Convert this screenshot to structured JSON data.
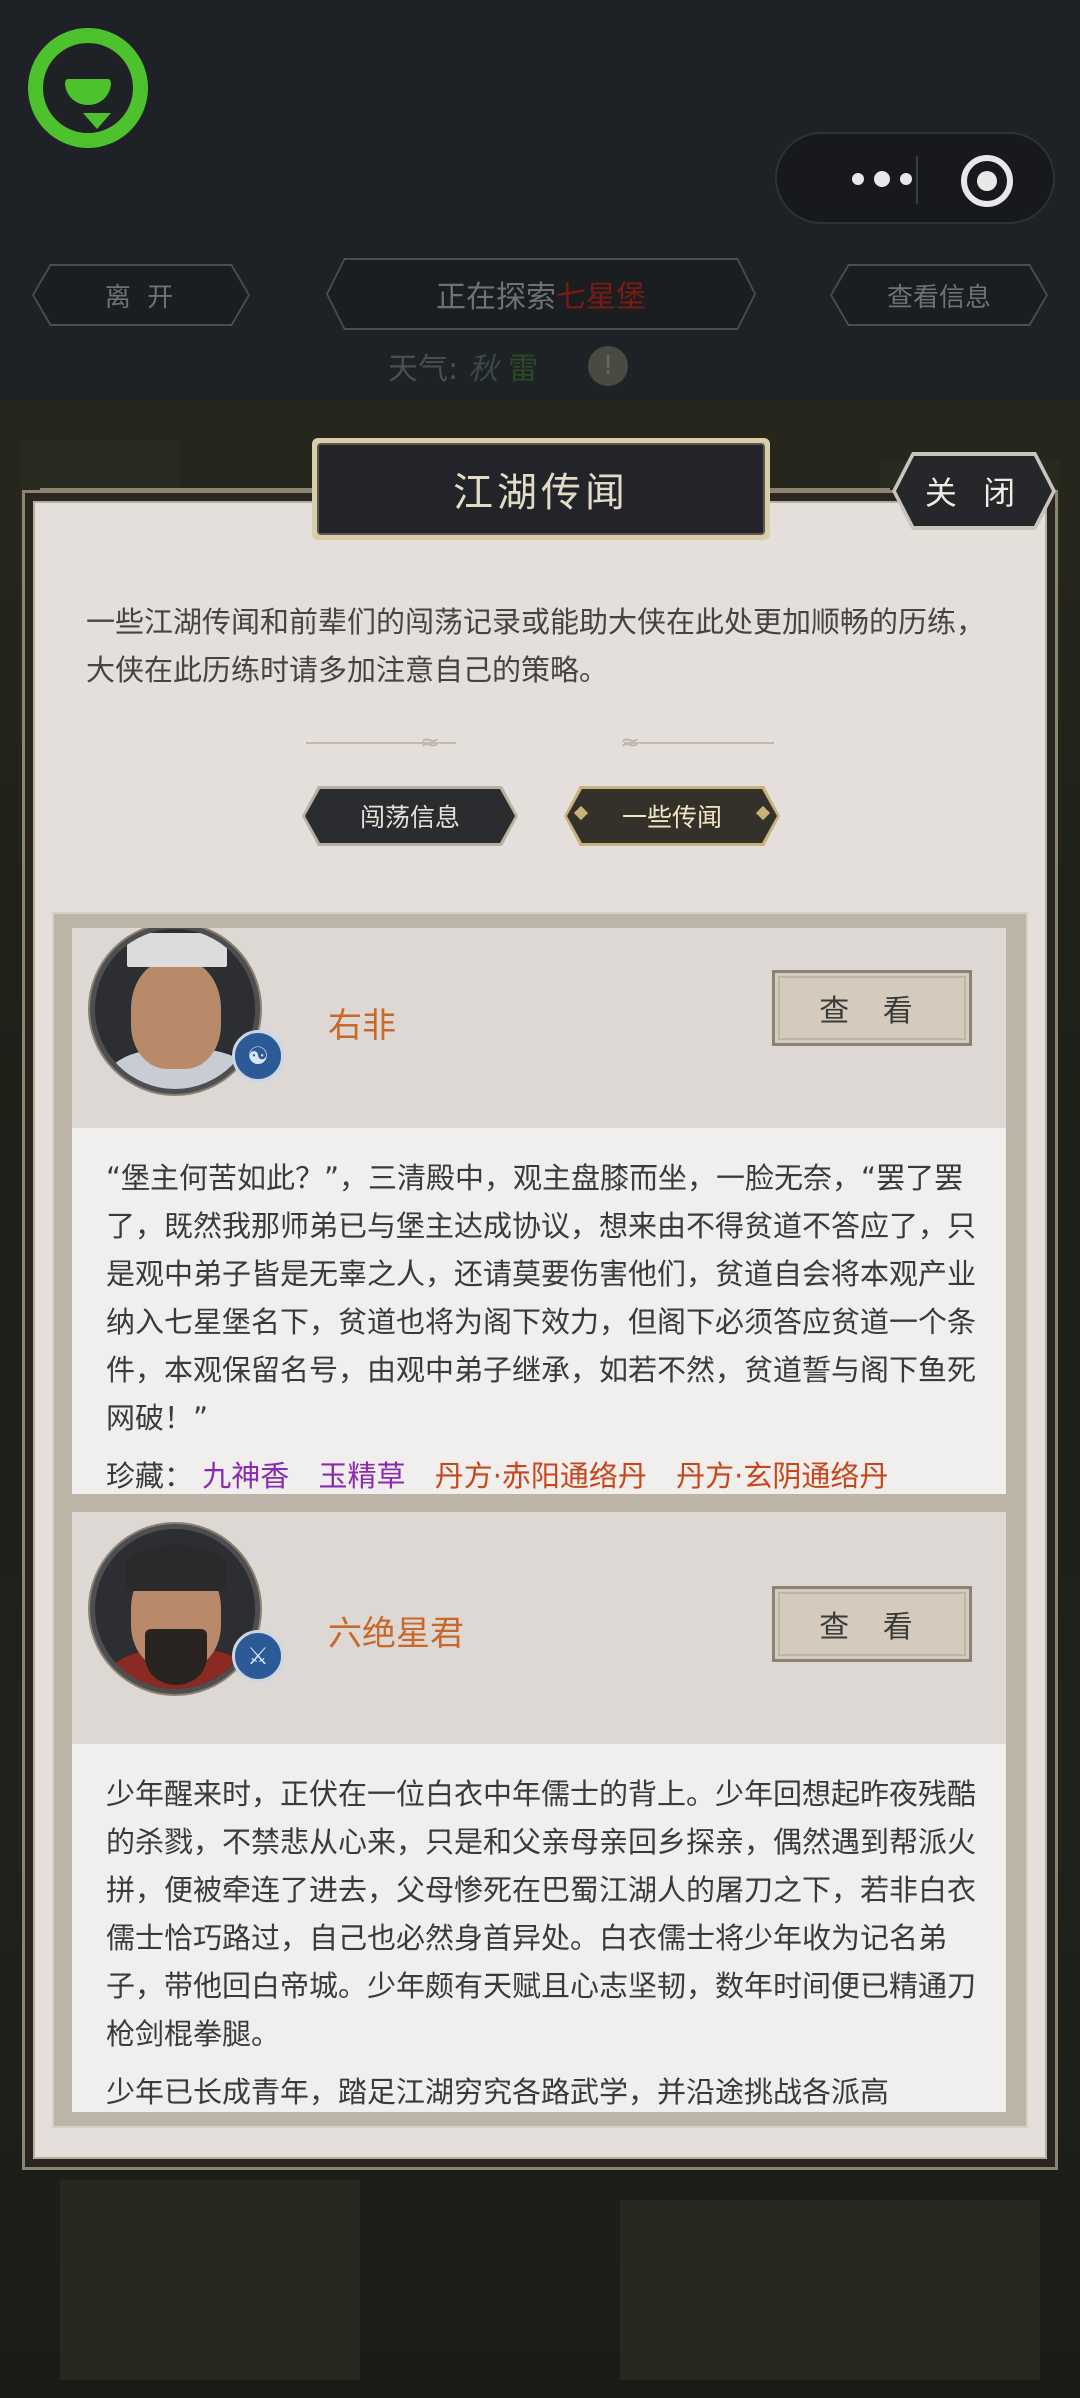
{
  "top": {
    "leave_label": "离 开",
    "exploring_prefix": "正在探索",
    "exploring_location": "七星堡",
    "view_info_label": "查看信息",
    "weather_label": "天气:",
    "weather_value_1": "秋",
    "weather_value_2": "雷",
    "warning_glyph": "!"
  },
  "dialog": {
    "title": "江湖传闻",
    "close_label": "关 闭",
    "intro": "一些江湖传闻和前辈们的闯荡记录或能助大侠在此处更加顺畅的历练，大侠在此历练时请多加注意自己的策略。",
    "tabs": [
      {
        "label": "闯荡信息",
        "active": false
      },
      {
        "label": "一些传闻",
        "active": true
      }
    ]
  },
  "cards": [
    {
      "name": "右非",
      "view_label": "查 看",
      "badge_icon": "taiji-badge-icon",
      "story": "“堡主何苦如此？”，三清殿中，观主盘膝而坐，一脸无奈，“罢了罢了，既然我那师弟已与堡主达成协议，想来由不得贫道不答应了，只是观中弟子皆是无辜之人，还请莫要伤害他们，贫道自会将本观产业纳入七星堡名下，贫道也将为阁下效力，但阁下必须答应贫道一个条件，本观保留名号，由观中弟子继承，如若不然，贫道誓与阁下鱼死网破！”",
      "treasure_label": "珍藏：",
      "treasures": [
        {
          "text": "九神香",
          "color": "purple"
        },
        {
          "text": "玉精草",
          "color": "purple"
        },
        {
          "text": "丹方·赤阳通络丹",
          "color": "orange"
        },
        {
          "text": "丹方·玄阴通络丹",
          "color": "orange"
        }
      ]
    },
    {
      "name": "六绝星君",
      "view_label": "查 看",
      "badge_icon": "sword-badge-icon",
      "story": "少年醒来时，正伏在一位白衣中年儒士的背上。少年回想起昨夜残酷的杀戮，不禁悲从心来，只是和父亲母亲回乡探亲，偶然遇到帮派火拼，便被牵连了进去，父母惨死在巴蜀江湖人的屠刀之下，若非白衣儒士恰巧路过，自己也必然身首异处。白衣儒士将少年收为记名弟子，带他回白帝城。少年颇有天赋且心志坚韧，数年时间便已精通刀枪剑棍拳腿。",
      "story_extra": "少年已长成青年，踏足江湖穷究各路武学，并沿途挑战各派高"
    }
  ],
  "colors": {
    "accent_name": "#c8682a",
    "purple_item": "#8a2ab0",
    "orange_item": "#c8461a",
    "brand_green": "#4dc22d"
  }
}
